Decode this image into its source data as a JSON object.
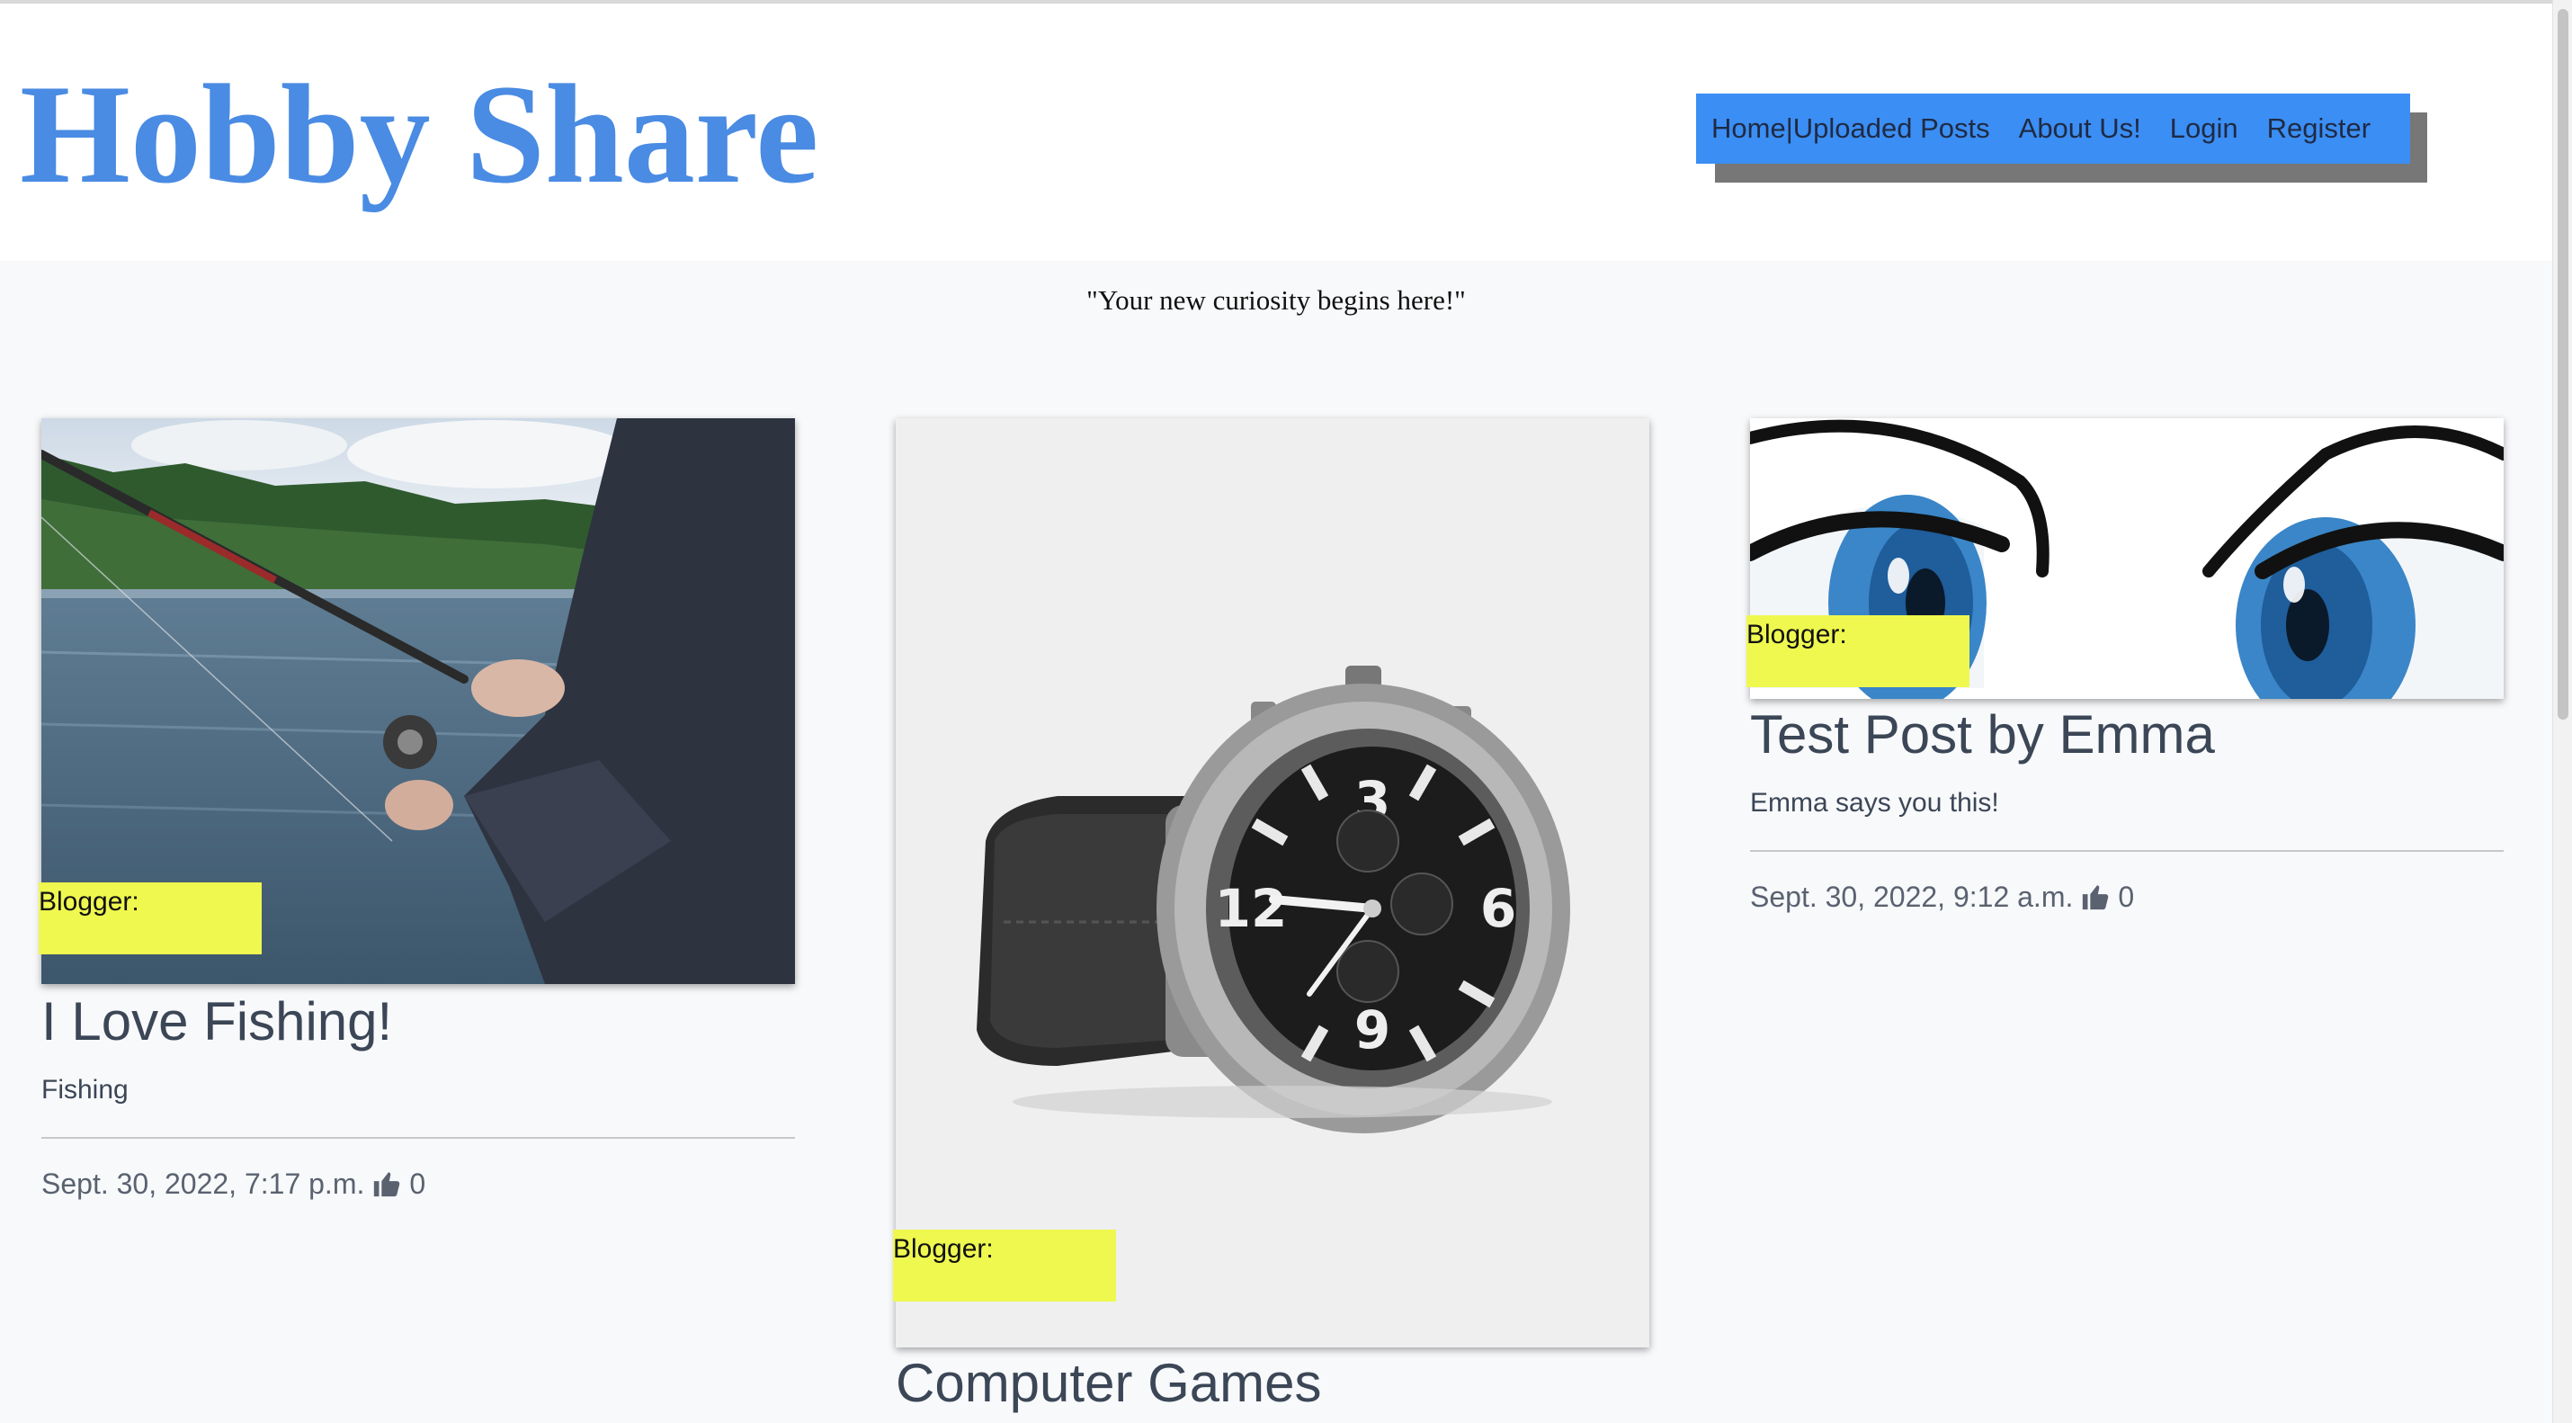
{
  "header": {
    "site_title": "Hobby Share",
    "nav": {
      "home": "Home",
      "separator": "|",
      "uploaded_posts": "Uploaded Posts",
      "about": "About Us!",
      "login": "Login",
      "register": "Register"
    }
  },
  "tagline": "\"Your new curiosity begins here!\"",
  "posts": [
    {
      "blogger_label": "Blogger:",
      "image": "fishing-photo",
      "title": "I Love Fishing!",
      "description": "Fishing",
      "date": "Sept. 30, 2022, 7:17 p.m.",
      "likes": "0"
    },
    {
      "blogger_label": "Blogger:",
      "image": "wristwatch-photo",
      "title": "Computer Games"
    },
    {
      "blogger_label": "Blogger:",
      "image": "cartoon-eyes-illustration",
      "title": "Test Post by Emma",
      "description": "Emma says you this!",
      "date": "Sept. 30, 2022, 9:12 a.m.",
      "likes": "0"
    }
  ],
  "icons": {
    "like": "thumbs-up-icon"
  },
  "colors": {
    "title": "#4a8be3",
    "nav_bg": "#3b8ef3",
    "blogger_highlight": "#eff84f",
    "page_bg": "#f8f9fb"
  }
}
